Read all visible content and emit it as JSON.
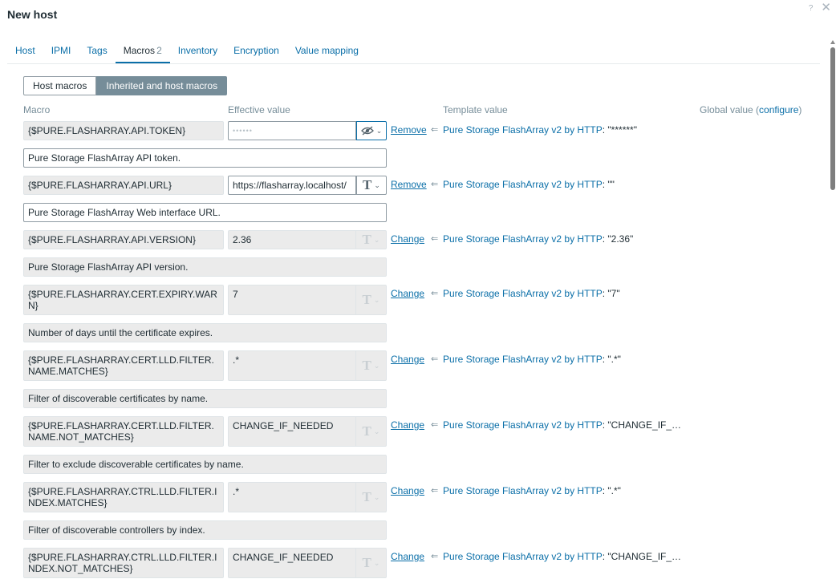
{
  "dialog": {
    "title": "New host",
    "help_label": "?"
  },
  "tabs": [
    {
      "label": "Host"
    },
    {
      "label": "IPMI"
    },
    {
      "label": "Tags"
    },
    {
      "label": "Macros",
      "count": "2"
    },
    {
      "label": "Inventory"
    },
    {
      "label": "Encryption"
    },
    {
      "label": "Value mapping"
    }
  ],
  "toggle": {
    "host_macros": "Host macros",
    "inherited": "Inherited and host macros"
  },
  "headers": {
    "macro": "Macro",
    "effective_value": "Effective value",
    "template_value": "Template value",
    "global_value": "Global value (",
    "configure": "configure",
    "close_paren": ")"
  },
  "template_name": "Pure Storage FlashArray v2 by HTTP",
  "macros": [
    {
      "name": "{$PURE.FLASHARRAY.API.TOKEN}",
      "value": "••••••",
      "type": "secret",
      "action": "Remove",
      "template_value": ": \"******\"",
      "description": "Pure Storage FlashArray API token."
    },
    {
      "name": "{$PURE.FLASHARRAY.API.URL}",
      "value": "https://flasharray.localhost/",
      "type": "text-editable",
      "action": "Remove",
      "template_value": ": \"\"",
      "description": "Pure Storage FlashArray Web interface URL."
    },
    {
      "name": "{$PURE.FLASHARRAY.API.VERSION}",
      "value": "2.36",
      "type": "text",
      "action": "Change",
      "template_value": ": \"2.36\"",
      "description": "Pure Storage FlashArray API version."
    },
    {
      "name": "{$PURE.FLASHARRAY.CERT.EXPIRY.WARN}",
      "value": "7",
      "type": "text",
      "action": "Change",
      "template_value": ": \"7\"",
      "description": "Number of days until the certificate expires."
    },
    {
      "name": "{$PURE.FLASHARRAY.CERT.LLD.FILTER.NAME.MATCHES}",
      "value": ".*",
      "type": "text",
      "action": "Change",
      "template_value": ": \".*\"",
      "description": "Filter of discoverable certificates by name."
    },
    {
      "name": "{$PURE.FLASHARRAY.CERT.LLD.FILTER.NAME.NOT_MATCHES}",
      "value": "CHANGE_IF_NEEDED",
      "type": "text",
      "action": "Change",
      "template_value": ": \"CHANGE_IF_…",
      "description": "Filter to exclude discoverable certificates by name."
    },
    {
      "name": "{$PURE.FLASHARRAY.CTRL.LLD.FILTER.INDEX.MATCHES}",
      "value": ".*",
      "type": "text",
      "action": "Change",
      "template_value": ": \".*\"",
      "description": "Filter of discoverable controllers by index."
    },
    {
      "name": "{$PURE.FLASHARRAY.CTRL.LLD.FILTER.INDEX.NOT_MATCHES}",
      "value": "CHANGE_IF_NEEDED",
      "type": "text",
      "action": "Change",
      "template_value": ": \"CHANGE_IF_…",
      "description": ""
    }
  ]
}
